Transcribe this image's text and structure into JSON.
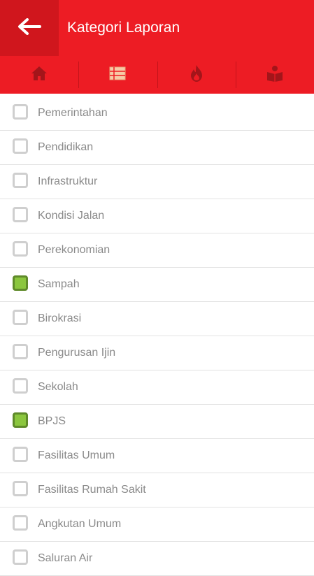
{
  "header": {
    "title": "Kategori Laporan"
  },
  "tabs": [
    {
      "icon": "home-icon"
    },
    {
      "icon": "list-icon"
    },
    {
      "icon": "fire-icon"
    },
    {
      "icon": "reading-icon"
    }
  ],
  "colors": {
    "primary": "#ed1c24",
    "back_bg": "#d0161d",
    "checked": "#8bc63e",
    "checked_border": "#5f8a2a",
    "unchecked_border": "#cfcfcf"
  },
  "categories": [
    {
      "label": "Pemerintahan",
      "checked": false
    },
    {
      "label": "Pendidikan",
      "checked": false
    },
    {
      "label": "Infrastruktur",
      "checked": false
    },
    {
      "label": "Kondisi Jalan",
      "checked": false
    },
    {
      "label": "Perekonomian",
      "checked": false
    },
    {
      "label": "Sampah",
      "checked": true
    },
    {
      "label": "Birokrasi",
      "checked": false
    },
    {
      "label": "Pengurusan Ijin",
      "checked": false
    },
    {
      "label": "Sekolah",
      "checked": false
    },
    {
      "label": "BPJS",
      "checked": true
    },
    {
      "label": "Fasilitas Umum",
      "checked": false
    },
    {
      "label": "Fasilitas Rumah Sakit",
      "checked": false
    },
    {
      "label": "Angkutan Umum",
      "checked": false
    },
    {
      "label": "Saluran Air",
      "checked": false
    }
  ]
}
